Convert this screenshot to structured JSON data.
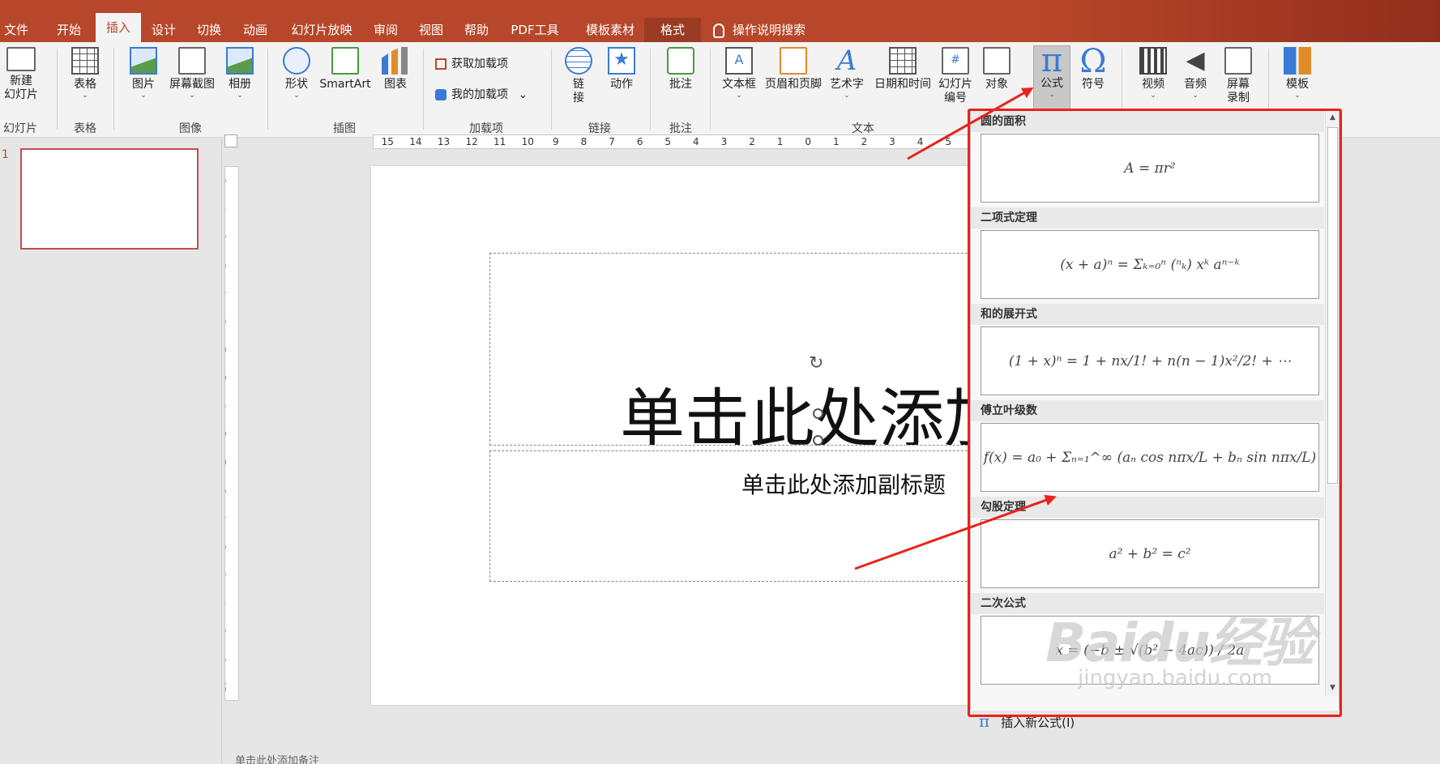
{
  "tabs": [
    "文件",
    "开始",
    "插入",
    "设计",
    "切换",
    "动画",
    "幻灯片放映",
    "审阅",
    "视图",
    "帮助",
    "PDF工具",
    "模板素材",
    "格式"
  ],
  "active_tab": "插入",
  "search": "操作说明搜索",
  "ribbon": {
    "new_slide": "新建\n幻灯片",
    "table": "表格",
    "picture": "图片",
    "screenshot": "屏幕截图",
    "album": "相册",
    "shapes": "形状",
    "smartart": "SmartArt",
    "chart": "图表",
    "get_addins": "获取加载项",
    "my_addins": "我的加载项",
    "link": "链\n接",
    "action": "动作",
    "comment": "批注",
    "textbox": "文本框",
    "header_footer": "页眉和页脚",
    "wordart": "艺术字",
    "datetime": "日期和时间",
    "slide_number": "幻灯片\n编号",
    "object": "对象",
    "equation": "公式",
    "symbol": "符号",
    "video": "视频",
    "audio": "音频",
    "screen_record": "屏幕\n录制",
    "template": "模板",
    "groups": {
      "slides": "幻灯片",
      "tables": "表格",
      "images": "图像",
      "illustrations": "插图",
      "addins": "加载项",
      "links": "链接",
      "comments": "批注",
      "text": "文本"
    }
  },
  "slide": {
    "number": "1",
    "title_placeholder": "单击此处添加标题",
    "subtitle_placeholder": "单击此处添加副标题"
  },
  "ruler": {
    "horizontal": [
      "15",
      "14",
      "13",
      "12",
      "11",
      "10",
      "9",
      "8",
      "7",
      "6",
      "5",
      "4",
      "3",
      "2",
      "1",
      "0",
      "1",
      "2",
      "3",
      "4",
      "5"
    ],
    "vertical": [
      "8",
      "7",
      "6",
      "5",
      "4",
      "3",
      "2",
      "1",
      "0",
      "1",
      "2",
      "3",
      "4",
      "5",
      "6",
      "7",
      "8",
      "9",
      "10"
    ]
  },
  "equation_gallery": {
    "items": [
      {
        "name": "圆的面积",
        "formula": "A = πr²"
      },
      {
        "name": "二项式定理",
        "formula": "(x + a)ⁿ = Σₖ₌₀ⁿ (ⁿₖ) xᵏ aⁿ⁻ᵏ"
      },
      {
        "name": "和的展开式",
        "formula": "(1 + x)ⁿ = 1 + nx/1! + n(n − 1)x²/2! + ⋯"
      },
      {
        "name": "傅立叶级数",
        "formula": "f(x) = a₀ + Σₙ₌₁^∞ (aₙ cos nπx/L + bₙ sin nπx/L)"
      },
      {
        "name": "勾股定理",
        "formula": "a² + b² = c²"
      },
      {
        "name": "二次公式",
        "formula": "x = (−b ± √(b² − 4ac)) / 2a"
      }
    ],
    "insert_new": "插入新公式(I)"
  },
  "notes": "单击此处添加备注",
  "watermark": {
    "brand": "Baidu经验",
    "url": "jingyan.baidu.com"
  },
  "colors": {
    "accent": "#b7472a",
    "highlight": "#e8231a",
    "equation_icon": "#3a7bd5"
  }
}
